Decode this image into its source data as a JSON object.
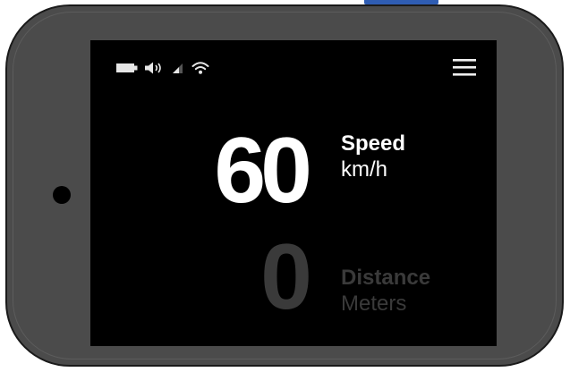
{
  "status_bar": {
    "icons": [
      "battery-icon",
      "volume-icon",
      "signal-icon",
      "wifi-icon"
    ]
  },
  "menu": {
    "icon": "hamburger-menu-icon"
  },
  "speed": {
    "value": "60",
    "label": "Speed",
    "unit": "km/h"
  },
  "distance": {
    "value": "0",
    "label": "Distance",
    "unit": "Meters"
  },
  "colors": {
    "device_body": "#4b4b4b",
    "device_edge": "#1a1a1a",
    "screen_background": "#000000",
    "primary_text": "#ffffff",
    "dimmed_text": "#3a3a3a",
    "hardware_button": "#2f5db3"
  }
}
